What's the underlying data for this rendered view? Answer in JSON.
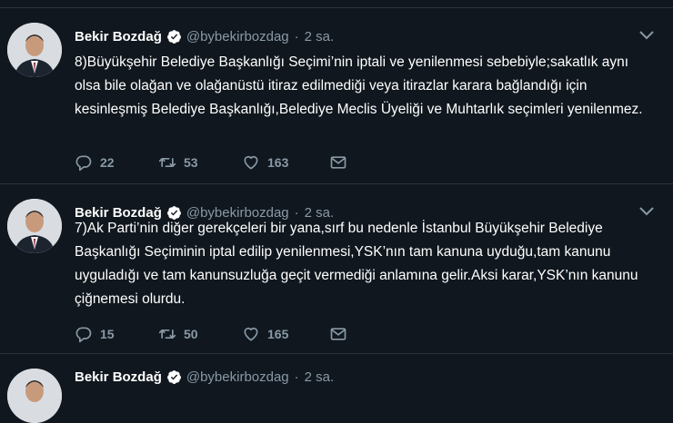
{
  "tweets": [
    {
      "name": "Bekir Bozdağ",
      "handle": "@bybekirbozdag",
      "separator": "·",
      "time": "2 sa.",
      "text": "8)Büyükşehir Belediye Başkanlığı Seçimi’nin iptali ve yenilenmesi sebebiyle;sakatlık aynı olsa bile olağan ve olağanüstü itiraz edilmediği veya itirazlar karara bağlandığı için kesinleşmiş Belediye Başkanlığı,Belediye Meclis Üyeliği ve Muhtarlık seçimleri yenilenmez.",
      "replies": "22",
      "retweets": "53",
      "likes": "163"
    },
    {
      "name": "Bekir Bozdağ",
      "handle": "@bybekirbozdag",
      "separator": "·",
      "time": "2 sa.",
      "text": "7)Ak Parti’nin diğer gerekçeleri bir yana,sırf bu nedenle İstanbul Büyükşehir Belediye Başkanlığı Seçiminin iptal edilip yenilenmesi,YSK’nın tam kanuna uyduğu,tam kanunu uyguladığı ve tam kanunsuzluğa geçit vermediği anlamına gelir.Aksi karar,YSK’nın kanunu çiğnemesi olurdu.",
      "replies": "15",
      "retweets": "50",
      "likes": "165"
    },
    {
      "name": "Bekir Bozdağ",
      "handle": "@bybekirbozdag",
      "separator": "·",
      "time": "2 sa."
    }
  ],
  "colors": {
    "background": "#10171e",
    "text": "#ffffff",
    "secondary": "#8899a6",
    "verified": "#ffffff",
    "border": "#2f3336"
  }
}
